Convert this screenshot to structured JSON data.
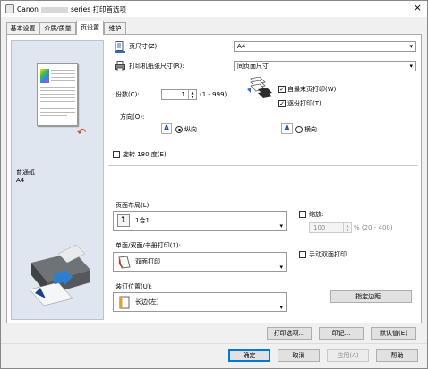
{
  "window": {
    "title_prefix": "Canon",
    "title_suffix": "series 打印首选项",
    "close": "×"
  },
  "tabs": [
    {
      "label": "基本设置"
    },
    {
      "label": "介质/质量"
    },
    {
      "label": "页设置"
    },
    {
      "label": "维护"
    }
  ],
  "preview": {
    "media_type": "普通纸",
    "paper_size": "A4"
  },
  "page_setup": {
    "page_size_label": "页尺寸(Z):",
    "page_size_value": "A4",
    "printer_paper_label": "打印机纸张尺寸(R):",
    "printer_paper_value": "同页面尺寸",
    "copies_label": "份数(C):",
    "copies_value": "1",
    "copies_range": "(1 - 999)",
    "print_from_last_label": "自最末页打印(W)",
    "print_from_last_checked": true,
    "collate_label": "逐份打印(T)",
    "collate_checked": true,
    "orientation_label": "方向(O):",
    "portrait_label": "纵向",
    "portrait_selected": true,
    "landscape_label": "横向",
    "rotate_label": "旋转 180 度(E)",
    "rotate_checked": false,
    "layout_label": "页面布局(L):",
    "layout_value": "1合1",
    "scaling_label": "缩放:",
    "scaling_value": "100",
    "scaling_range": "% (20 - 400)",
    "duplex_label": "单面/双面/书册打印(1):",
    "duplex_value": "双面打印",
    "manual_duplex_label": "手动双面打印",
    "manual_duplex_checked": false,
    "binding_label": "装订位置(U):",
    "binding_value": "长边(左)",
    "margin_button": "指定边距..."
  },
  "panel_buttons": {
    "print_options": "打印选项...",
    "stamp": "印记...",
    "defaults": "默认值(E)"
  },
  "dialog_buttons": {
    "ok": "确定",
    "cancel": "取消",
    "apply": "应用(A)",
    "help": "帮助"
  },
  "icons": {
    "dropdown": "▾",
    "spin_up": "▲",
    "spin_down": "▼",
    "check": "✓",
    "orientation_a": "A",
    "layout_num": "1",
    "flip_arrow": "↶"
  }
}
